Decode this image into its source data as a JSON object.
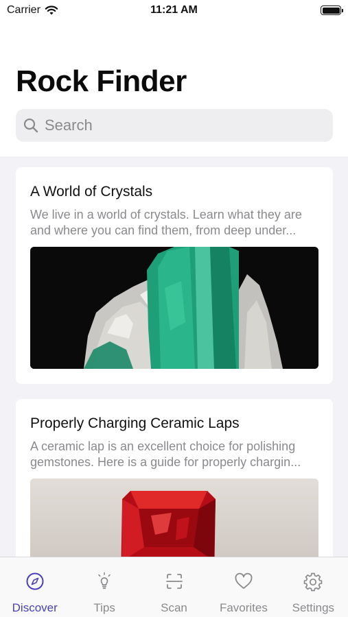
{
  "status_bar": {
    "carrier": "Carrier",
    "time": "11:21 AM"
  },
  "header": {
    "title": "Rock Finder"
  },
  "search": {
    "placeholder": "Search"
  },
  "cards": [
    {
      "title": "A World of Crystals",
      "desc_line1": "We live in a world of crystals. Learn what they are",
      "desc_line2": "and where you can find them, from deep under..."
    },
    {
      "title": "Properly Charging Ceramic Laps",
      "desc_line1": "A ceramic lap is an excellent choice for polishing",
      "desc_line2": "gemstones. Here is a guide for properly chargin..."
    }
  ],
  "tabs": [
    {
      "label": "Discover",
      "icon": "compass-icon",
      "active": true
    },
    {
      "label": "Tips",
      "icon": "lightbulb-icon",
      "active": false
    },
    {
      "label": "Scan",
      "icon": "scan-icon",
      "active": false
    },
    {
      "label": "Favorites",
      "icon": "heart-icon",
      "active": false
    },
    {
      "label": "Settings",
      "icon": "gear-icon",
      "active": false
    }
  ],
  "colors": {
    "accent": "#4b3fb8",
    "inactive": "#8a8a8e",
    "feed_background": "#f2f2f7"
  }
}
